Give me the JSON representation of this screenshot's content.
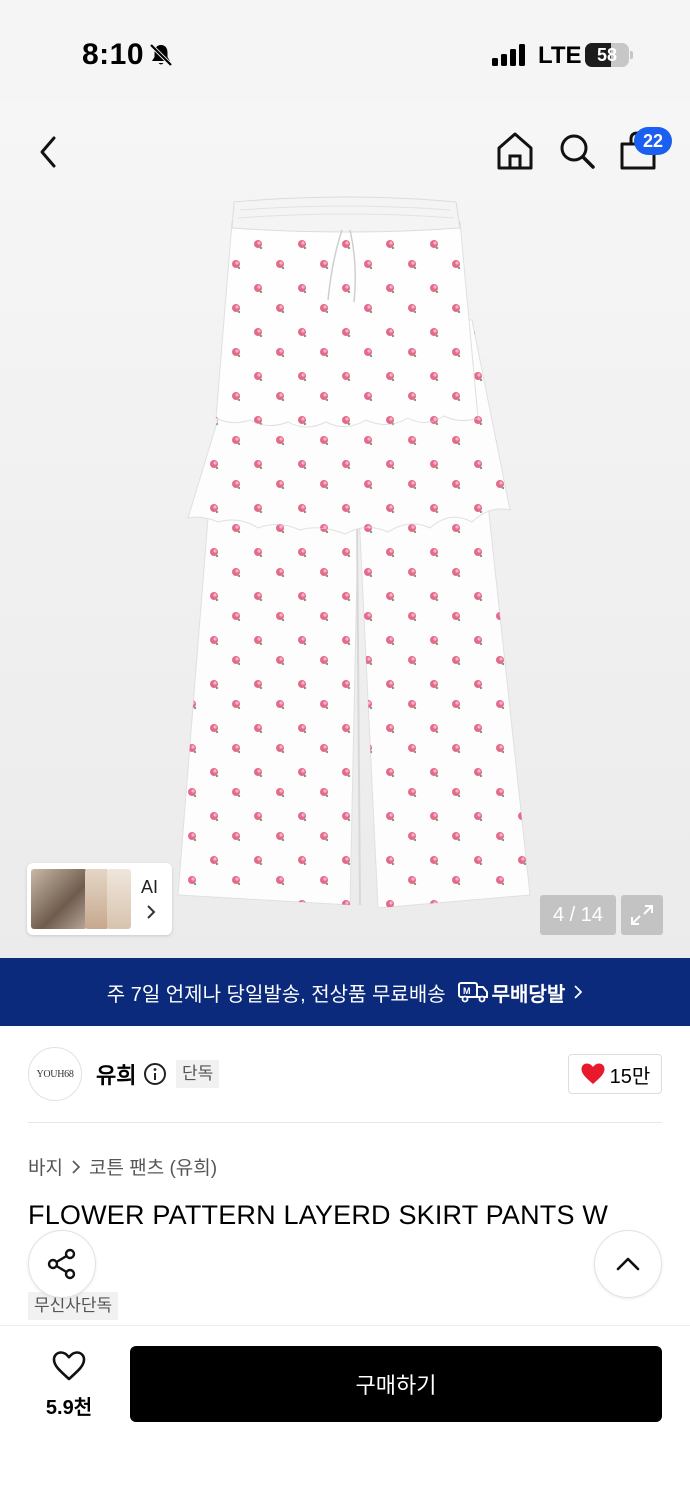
{
  "status_bar": {
    "time": "8:10",
    "network": "LTE",
    "battery": "58",
    "battery_level_pct": 58
  },
  "nav": {
    "cart_count": "22"
  },
  "gallery": {
    "ai_label": "AI",
    "counter": "4 / 14"
  },
  "banner": {
    "text": "주 7일 언제나 당일발송, 전상품 무료배송",
    "logo_text": "무배당발"
  },
  "brand": {
    "logo_text": "YOUH68",
    "name": "유희",
    "badge": "단독",
    "likes": "15만"
  },
  "product": {
    "breadcrumb": [
      "바지",
      "코튼 팬츠 (유희)"
    ],
    "title": "FLOWER PATTERN LAYERD SKIRT PANTS W",
    "tag": "무신사단독"
  },
  "bottom": {
    "wish_count": "5.9천",
    "buy_label": "구매하기"
  },
  "colors": {
    "banner_bg": "#0b2a7c",
    "badge_blue": "#1a5ff0",
    "heart_red": "#e8192c",
    "button_black": "#000000"
  }
}
